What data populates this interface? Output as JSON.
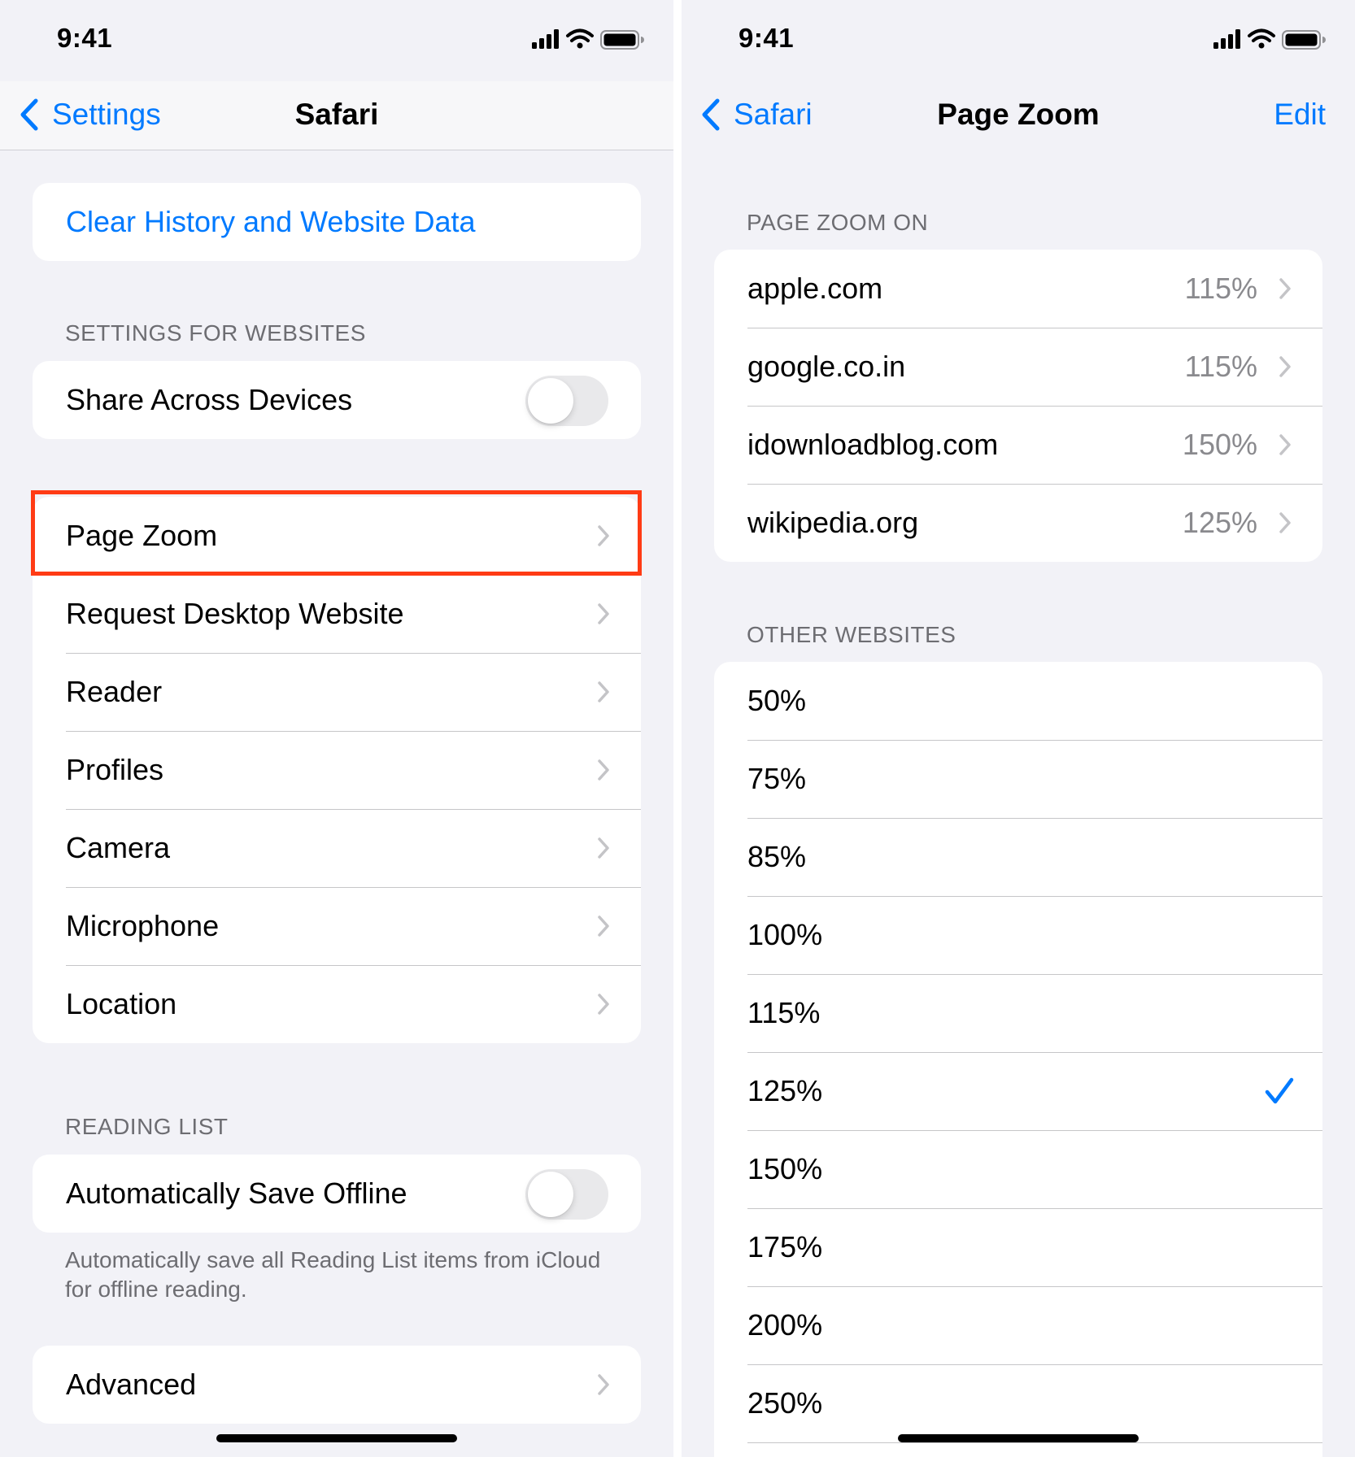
{
  "left_screen": {
    "status": {
      "time": "9:41"
    },
    "nav": {
      "back_label": "Settings",
      "title": "Safari"
    },
    "clear_history_label": "Clear History and Website Data",
    "settings_for_websites": {
      "header": "SETTINGS FOR WEBSITES",
      "share_label": "Share Across Devices",
      "share_toggle_on": false
    },
    "website_items": [
      "Page Zoom",
      "Request Desktop Website",
      "Reader",
      "Profiles",
      "Camera",
      "Microphone",
      "Location"
    ],
    "reading_list": {
      "header": "READING LIST",
      "auto_save_label": "Automatically Save Offline",
      "auto_save_toggle_on": false,
      "footer": "Automatically save all Reading List items from iCloud for offline reading."
    },
    "advanced_label": "Advanced",
    "highlight_color": "#ff3b15"
  },
  "right_screen": {
    "status": {
      "time": "9:41"
    },
    "nav": {
      "back_label": "Safari",
      "title": "Page Zoom",
      "edit_label": "Edit"
    },
    "page_zoom_on": {
      "header": "PAGE ZOOM ON",
      "sites": [
        {
          "domain": "apple.com",
          "zoom": "115%"
        },
        {
          "domain": "google.co.in",
          "zoom": "115%"
        },
        {
          "domain": "idownloadblog.com",
          "zoom": "150%"
        },
        {
          "domain": "wikipedia.org",
          "zoom": "125%"
        }
      ]
    },
    "other_websites": {
      "header": "OTHER WEBSITES",
      "options": [
        "50%",
        "75%",
        "85%",
        "100%",
        "115%",
        "125%",
        "150%",
        "175%",
        "200%",
        "250%"
      ],
      "selected": "125%"
    }
  },
  "colors": {
    "accent": "#007aff",
    "background": "#f2f2f7",
    "secondary_text": "#6d6d72"
  },
  "icons": {
    "back": "chevron-left-icon",
    "disclosure": "chevron-right-icon",
    "selected": "checkmark-icon",
    "signal": "cellular-signal-icon",
    "wifi": "wifi-icon",
    "battery": "battery-icon"
  }
}
